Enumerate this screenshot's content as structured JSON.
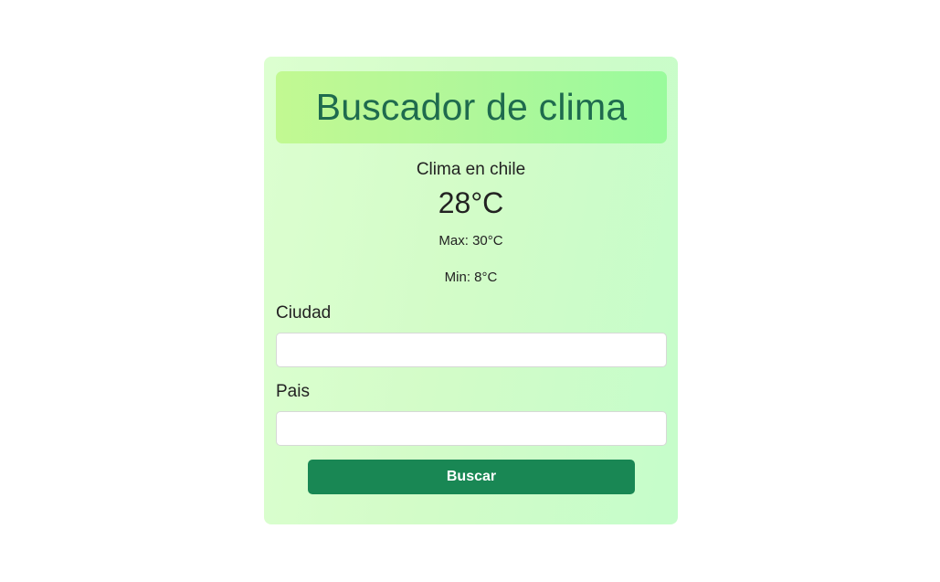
{
  "header": {
    "title": "Buscador de clima"
  },
  "weather": {
    "title": "Clima en chile",
    "temperature": "28°C",
    "max": "Max: 30°C",
    "min": "Min: 8°C"
  },
  "form": {
    "city_label": "Ciudad",
    "city_value": "",
    "country_label": "Pais",
    "country_value": "",
    "submit_label": "Buscar"
  },
  "colors": {
    "button": "#198754",
    "title": "#1f6b4e",
    "header_start": "#c2f992",
    "header_end": "#99fb9c",
    "card_bg": "#d3fcc8"
  }
}
